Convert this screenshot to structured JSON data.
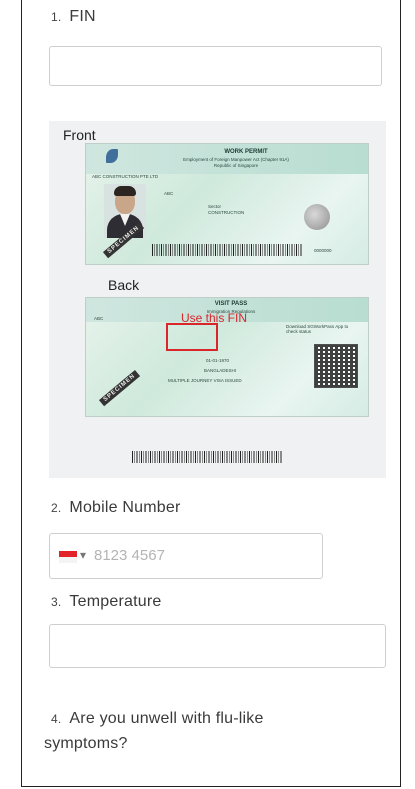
{
  "questions": {
    "q1": {
      "number": "1.",
      "label": "FIN"
    },
    "q2": {
      "number": "2.",
      "label": "Mobile Number"
    },
    "q3": {
      "number": "3.",
      "label": "Temperature"
    },
    "q4": {
      "number": "4.",
      "label": "Are you unwell with flu-like",
      "label_line2": "symptoms?"
    }
  },
  "fin_input": {
    "value": "",
    "placeholder": ""
  },
  "phone_input": {
    "placeholder": "8123 4567",
    "country": "Singapore",
    "caret": "▾",
    "flag_colors": {
      "top": "#e2232a",
      "bottom": "#f4f4f4"
    }
  },
  "temperature_input": {
    "value": "",
    "placeholder": ""
  },
  "id_guide": {
    "front_label": "Front",
    "back_label": "Back",
    "note": "Use this FIN",
    "note_color": "#d8262b",
    "front_card": {
      "title": "WORK PERMIT",
      "subtitle": "Employment of Foreign Manpower Act (Chapter 91A)",
      "subtitle2": "Republic of Singapore",
      "employer": "ABC CONSTRUCTION PTE LTD",
      "name": "ABC",
      "occupation_label": "Sector",
      "sector": "CONSTRUCTION",
      "serial": "0000000",
      "specimen": "SPECIMEN"
    },
    "back_card": {
      "title": "VISIT PASS",
      "subtitle": "Immigration Regulations",
      "name": "ABC",
      "dob": "01-01-1970",
      "nationality": "BANGLADESHI",
      "pass_type": "MULTIPLE JOURNEY VISA ISSUED",
      "download_text": "Download SGWorkPass App to check status",
      "specimen": "SPECIMEN"
    }
  }
}
